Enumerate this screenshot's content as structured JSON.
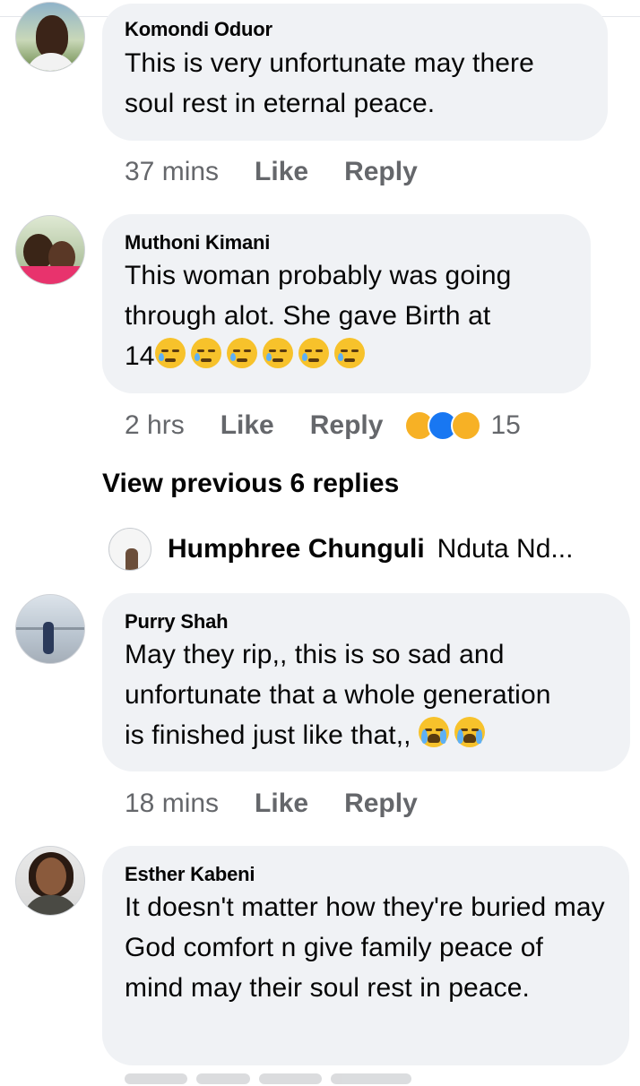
{
  "comments": [
    {
      "author": "Komondi Oduor",
      "text": "This is very unfortunate may there soul rest in eternal peace.",
      "time": "37 mins",
      "like_label": "Like",
      "reply_label": "Reply"
    },
    {
      "author": "Muthoni Kimani",
      "text_line1": "This woman probably was  going",
      "text_line2": "through alot. She gave Birth at",
      "text_line3": "14",
      "emoji_count": 6,
      "time": "2 hrs",
      "like_label": "Like",
      "reply_label": "Reply",
      "reactions": [
        "sad-reaction",
        "like-reaction",
        "wow-reaction"
      ],
      "reaction_count": "15"
    },
    {
      "author": "Purry Shah",
      "text_line1": "May they rip,, this is so sad and",
      "text_line2": "unfortunate that a whole generation",
      "text_line3": "is finished just like that,,",
      "time": "18 mins",
      "like_label": "Like",
      "reply_label": "Reply"
    },
    {
      "author": "Esther Kabeni",
      "text": "It doesn't matter how they're buried may God comfort n give family peace of mind may their soul rest in peace."
    }
  ],
  "view_previous": "View previous 6 replies",
  "reply_preview": {
    "author": "Humphree Chunguli",
    "snippet": "Nduta Nd..."
  },
  "colors": {
    "bubble": "#f0f2f5",
    "meta_text": "#65676b",
    "like_blue": "#1877f2",
    "reaction_yellow": "#f7b125"
  }
}
